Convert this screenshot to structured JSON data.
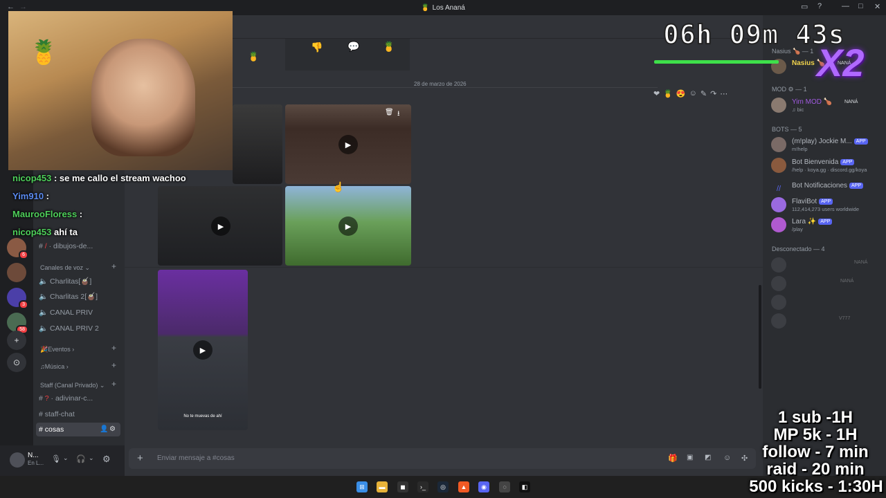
{
  "window": {
    "title": "Los Ananá"
  },
  "channels": {
    "rows_top": [
      {
        "label": "dibujos-de...",
        "icon": "#"
      }
    ],
    "voice_category": "Canales de voz",
    "voice": [
      {
        "label": "Charlitas[🧉]"
      },
      {
        "label": "Charlitas 2[🧉]"
      },
      {
        "label": "CANAL PRIV"
      },
      {
        "label": "CANAL PRIV 2"
      }
    ],
    "eventos": "Eventos",
    "musica": "Música",
    "staff_category": "Staff (Canal Privado)",
    "staff": [
      {
        "label": "adivinar-c..."
      },
      {
        "label": "staff-chat"
      },
      {
        "label": "cosas"
      }
    ]
  },
  "userbar": {
    "name": "N...",
    "status": "En L..."
  },
  "main": {
    "date_divider": "28 de marzo de 2026",
    "video_caption": "No te muevas de ahí",
    "chat_placeholder": "Enviar mensaje a #cosas"
  },
  "members": {
    "group_nasius": "Nasius 🍗 — 1",
    "nasius": {
      "name": "Nasius 🍗",
      "tag": "NANÁ"
    },
    "group_mod": "MOD ⚙ — 1",
    "mod": {
      "name": "Yim MOD 🍗",
      "tag": "NANÁ",
      "sub": "bic"
    },
    "group_bots": "BOTS — 5",
    "bots": [
      {
        "name": "(m!play) Jockie M...",
        "sub": "m!help",
        "tag": "APP"
      },
      {
        "name": "Bot Bienvenida",
        "sub": "/help · koya.gg · discord.gg/koya",
        "tag": "APP"
      },
      {
        "name": "Bot Notificaciones",
        "sub": "",
        "tag": "APP"
      },
      {
        "name": "FlaviBot",
        "sub": "112,414,273 users worldwide",
        "tag": "APP"
      },
      {
        "name": "Lara ✨",
        "sub": "/play",
        "tag": "APP"
      }
    ],
    "group_offline": "Desconectado — 4",
    "offline_tags": [
      "NANÁ",
      "NANÁ",
      "",
      "V777"
    ]
  },
  "overlay": {
    "timer": "06h 09m 43s",
    "multiplier": "X2",
    "chat": [
      {
        "user": "nicop453",
        "text": "se me callo el stream wachoo"
      },
      {
        "user": "Yim910",
        "text": ""
      },
      {
        "user": "MaurooFloress",
        "text": ""
      },
      {
        "user": "nicop453",
        "text": "ahí ta"
      }
    ],
    "rules": [
      "1 sub -1H",
      "MP 5k - 1H",
      "follow - 7 min",
      "raid - 20 min",
      "500 kicks - 1:30H"
    ]
  },
  "colors": {
    "accent": "#5865f2",
    "timer_bar": "#3ee04a",
    "overlay_x2": "#b069ff"
  }
}
